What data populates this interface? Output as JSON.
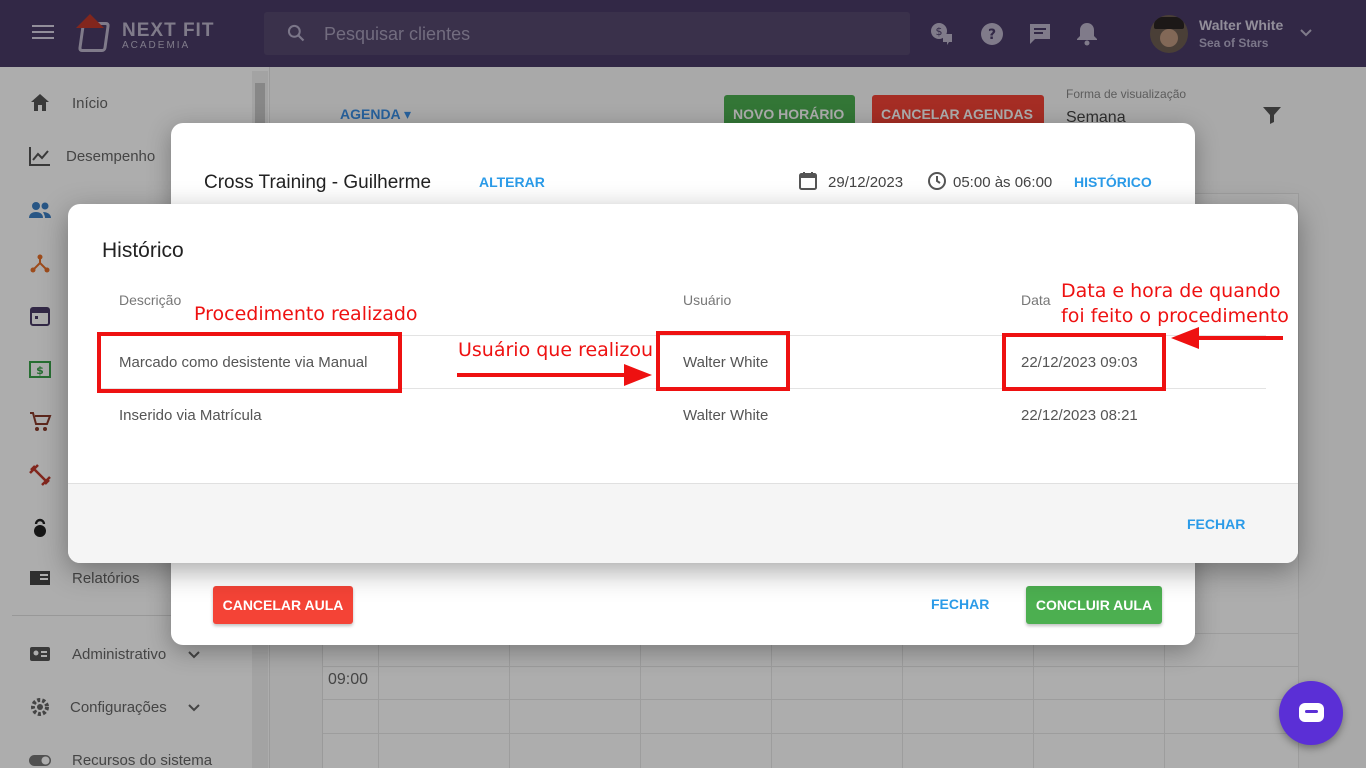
{
  "topbar": {
    "logo_text": "NEXT FIT",
    "logo_sub": "ACADEMIA",
    "search_placeholder": "Pesquisar clientes",
    "user_name": "Walter White",
    "user_org": "Sea of Stars"
  },
  "sidebar": {
    "items": [
      {
        "label": "Início",
        "icon": "home-icon"
      },
      {
        "label": "Desempenho",
        "icon": "chart-line-icon"
      },
      {
        "label": "",
        "icon": "people-icon"
      },
      {
        "label": "",
        "icon": "hierarchy-icon"
      },
      {
        "label": "",
        "icon": "calendar-icon"
      },
      {
        "label": "",
        "icon": "money-icon"
      },
      {
        "label": "",
        "icon": "cart-icon"
      },
      {
        "label": "",
        "icon": "dumbbell-icon"
      },
      {
        "label": "",
        "icon": "kettlebell-icon"
      },
      {
        "label": "Relatórios",
        "icon": "report-icon"
      },
      {
        "label": "Administrativo",
        "icon": "id-card-icon"
      },
      {
        "label": "Configurações",
        "icon": "gear-icon"
      },
      {
        "label": "Recursos do sistema",
        "icon": "toggle-icon"
      }
    ]
  },
  "agenda": {
    "link": "AGENDA",
    "novo_horario": "NOVO HORÁRIO",
    "cancelar_agendas": "CANCELAR AGENDAS",
    "view_label": "Forma de visualização",
    "view_value": "Semana",
    "time_label": "09:00"
  },
  "class_dialog": {
    "title": "Cross Training - Guilherme",
    "alterar": "ALTERAR",
    "date": "29/12/2023",
    "time": "05:00 às 06:00",
    "historico": "HISTÓRICO",
    "cancelar_aula": "CANCELAR AULA",
    "fechar": "FECHAR",
    "concluir_aula": "CONCLUIR AULA"
  },
  "history_dialog": {
    "title": "Histórico",
    "columns": [
      "Descrição",
      "Usuário",
      "Data"
    ],
    "rows": [
      {
        "descricao": "Marcado como desistente via Manual",
        "usuario": "Walter White",
        "data": "22/12/2023 09:03"
      },
      {
        "descricao": "Inserido via Matrícula",
        "usuario": "Walter White",
        "data": "22/12/2023 08:21"
      }
    ],
    "fechar": "FECHAR"
  },
  "annotations": {
    "procedimento": "Procedimento realizado",
    "usuario": "Usuário que realizou",
    "data_line1": "Data e hora de quando",
    "data_line2": "foi feito o procedimento",
    "color": "#ee1111"
  },
  "colors": {
    "topbar": "#4a3c68",
    "link_blue": "#2b9be8",
    "danger": "#f44336",
    "success": "#4caf50",
    "chat": "#5b2fd6"
  }
}
